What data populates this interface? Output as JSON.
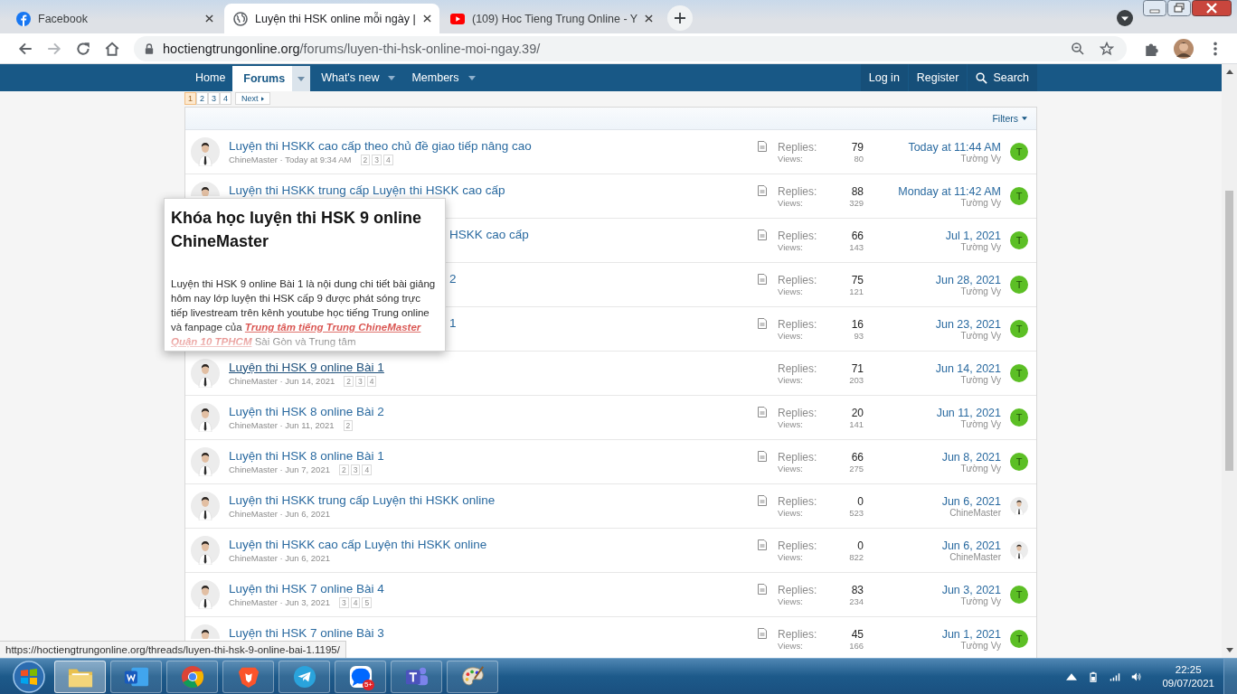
{
  "browser": {
    "tabs": [
      {
        "title": "Facebook",
        "selected": false
      },
      {
        "title": "Luyện thi HSK online mỗi ngày |",
        "selected": true
      },
      {
        "title": "(109) Hoc Tieng Trung Online - Y",
        "selected": false
      }
    ],
    "url": {
      "host": "hoctiengtrungonline.org",
      "path": "/forums/luyen-thi-hsk-online-moi-ngay.39/"
    }
  },
  "nav": {
    "left": [
      {
        "label": "Home",
        "selected": false,
        "dropdown": false
      },
      {
        "label": "Forums",
        "selected": true,
        "dropdown": true
      },
      {
        "label": "What's new",
        "selected": false,
        "dropdown": true
      },
      {
        "label": "Members",
        "selected": false,
        "dropdown": true
      }
    ],
    "right": [
      {
        "label": "Log in",
        "kind": "plain"
      },
      {
        "label": "Register",
        "kind": "plain"
      },
      {
        "label": "Search",
        "kind": "search"
      }
    ]
  },
  "pagination": {
    "pages": [
      {
        "label": "1",
        "selected": true
      },
      {
        "label": "2",
        "selected": false
      },
      {
        "label": "3",
        "selected": false
      },
      {
        "label": "4",
        "selected": false
      }
    ],
    "next": "Next"
  },
  "filters": "Filters",
  "threads": [
    {
      "kind": "full",
      "avatar": {
        "kind": "whole"
      },
      "title": "Luyện thi HSKK cao cấp theo chủ đề giao tiếp nâng cao",
      "meta": "ChineMaster · Today at 9:34 AM",
      "pages": [
        "2",
        "3",
        "4"
      ],
      "hovered": false,
      "replies_label": "Replies:",
      "replies": "79",
      "views_label": "Views:",
      "views": "80",
      "last_date": "Today at 11:44 AM",
      "last_user": "Tường Vy",
      "last_avatar": {
        "kind": "letter",
        "letter": "T"
      }
    },
    {
      "kind": "full",
      "avatar": {
        "kind": "peek"
      },
      "title": "Luyện thi HSKK trung cấp Luyện thi HSKK cao cấp",
      "hovered": false,
      "replies_label": "Replies:",
      "replies": "88",
      "views_label": "Views:",
      "views": "329",
      "last_date": "Monday at 11:42 AM",
      "last_user": "Tường Vy",
      "last_avatar": {
        "kind": "letter",
        "letter": "T"
      }
    },
    {
      "kind": "covered",
      "title": "HSKK cao cấp",
      "hovered": false,
      "replies_label": "Replies:",
      "replies": "66",
      "views_label": "Views:",
      "views": "143",
      "last_date": "Jul 1, 2021",
      "last_user": "Tường Vy",
      "last_avatar": {
        "kind": "letter",
        "letter": "T"
      }
    },
    {
      "kind": "covered",
      "title": "2",
      "hovered": false,
      "replies_label": "Replies:",
      "replies": "75",
      "views_label": "Views:",
      "views": "121",
      "last_date": "Jun 28, 2021",
      "last_user": "Tường Vy",
      "last_avatar": {
        "kind": "letter",
        "letter": "T"
      }
    },
    {
      "kind": "covered",
      "title": "1",
      "hovered": false,
      "replies_label": "Replies:",
      "replies": "16",
      "views_label": "Views:",
      "views": "93",
      "last_date": "Jun 23, 2021",
      "last_user": "Tường Vy",
      "last_avatar": {
        "kind": "letter",
        "letter": "T"
      }
    },
    {
      "kind": "full",
      "avatar": {
        "kind": "whole"
      },
      "title": "Luyện thi HSK 9 online Bài 1",
      "meta": "ChineMaster · Jun 14, 2021",
      "pages": [
        "2",
        "3",
        "4"
      ],
      "hovered": true,
      "replies_label": "Replies:",
      "replies": "71",
      "views_label": "Views:",
      "views": "203",
      "last_date": "Jun 14, 2021",
      "last_user": "Tường Vy",
      "last_avatar": {
        "kind": "letter",
        "letter": "T"
      }
    },
    {
      "kind": "full",
      "avatar": {
        "kind": "whole"
      },
      "title": "Luyện thi HSK 8 online Bài 2",
      "meta": "ChineMaster · Jun 11, 2021",
      "pages": [
        "2"
      ],
      "hovered": false,
      "replies_label": "Replies:",
      "replies": "20",
      "views_label": "Views:",
      "views": "141",
      "last_date": "Jun 11, 2021",
      "last_user": "Tường Vy",
      "last_avatar": {
        "kind": "letter",
        "letter": "T"
      }
    },
    {
      "kind": "full",
      "avatar": {
        "kind": "whole"
      },
      "title": "Luyện thi HSK 8 online Bài 1",
      "meta": "ChineMaster · Jun 7, 2021",
      "pages": [
        "2",
        "3",
        "4"
      ],
      "hovered": false,
      "replies_label": "Replies:",
      "replies": "66",
      "views_label": "Views:",
      "views": "275",
      "last_date": "Jun 8, 2021",
      "last_user": "Tường Vy",
      "last_avatar": {
        "kind": "letter",
        "letter": "T"
      }
    },
    {
      "kind": "full",
      "avatar": {
        "kind": "whole"
      },
      "title": "Luyện thi HSKK trung cấp Luyện thi HSKK online",
      "meta": "ChineMaster · Jun 6, 2021",
      "hovered": false,
      "replies_label": "Replies:",
      "replies": "0",
      "views_label": "Views:",
      "views": "523",
      "last_date": "Jun 6, 2021",
      "last_user": "ChineMaster",
      "last_avatar": {
        "kind": "photo"
      }
    },
    {
      "kind": "full",
      "avatar": {
        "kind": "whole"
      },
      "title": "Luyện thi HSKK cao cấp Luyện thi HSKK online",
      "meta": "ChineMaster · Jun 6, 2021",
      "hovered": false,
      "replies_label": "Replies:",
      "replies": "0",
      "views_label": "Views:",
      "views": "822",
      "last_date": "Jun 6, 2021",
      "last_user": "ChineMaster",
      "last_avatar": {
        "kind": "photo"
      }
    },
    {
      "kind": "full",
      "avatar": {
        "kind": "whole"
      },
      "title": "Luyện thi HSK 7 online Bài 4",
      "meta": "ChineMaster · Jun 3, 2021",
      "pages": [
        "3",
        "4",
        "5"
      ],
      "hovered": false,
      "replies_label": "Replies:",
      "replies": "83",
      "views_label": "Views:",
      "views": "234",
      "last_date": "Jun 3, 2021",
      "last_user": "Tường Vy",
      "last_avatar": {
        "kind": "letter",
        "letter": "T"
      }
    },
    {
      "kind": "full",
      "avatar": {
        "kind": "peek"
      },
      "title": "Luyện thi HSK 7 online Bài 3",
      "hovered": false,
      "replies_label": "Replies:",
      "replies": "45",
      "views_label": "Views:",
      "views": "166",
      "last_date": "Jun 1, 2021",
      "last_user": "Tường Vy",
      "last_avatar": {
        "kind": "letter",
        "letter": "T"
      }
    }
  ],
  "tooltip": {
    "title": "Khóa học luyện thi HSK 9 online ChineMaster",
    "body": "Luyện thi HSK 9 online Bài 1 là nội dung chi tiết bài giảng hôm nay lớp luyện thi HSK cấp 9 được phát sóng trực tiếp livestream trên kênh youtube học tiếng Trung online và fanpage của **Trung tâm tiếng Trung ChineMaster Quận 10 TPHCM** Sài Gòn và Trung tâm"
  },
  "status_url": "https://hoctiengtrungonline.org/threads/luyen-thi-hsk-9-online-bai-1.1195/",
  "taskbar": {
    "apps": [
      {
        "kind": "explorer",
        "active": true
      },
      {
        "kind": "word",
        "active": false
      },
      {
        "kind": "chrome",
        "active": false
      },
      {
        "kind": "brave",
        "active": false
      },
      {
        "kind": "telegram",
        "active": false
      },
      {
        "kind": "zalo",
        "active": false,
        "badge": "5+"
      },
      {
        "kind": "teams",
        "active": false
      },
      {
        "kind": "paint",
        "active": false
      }
    ],
    "time": "22:25",
    "date": "09/07/2021"
  }
}
